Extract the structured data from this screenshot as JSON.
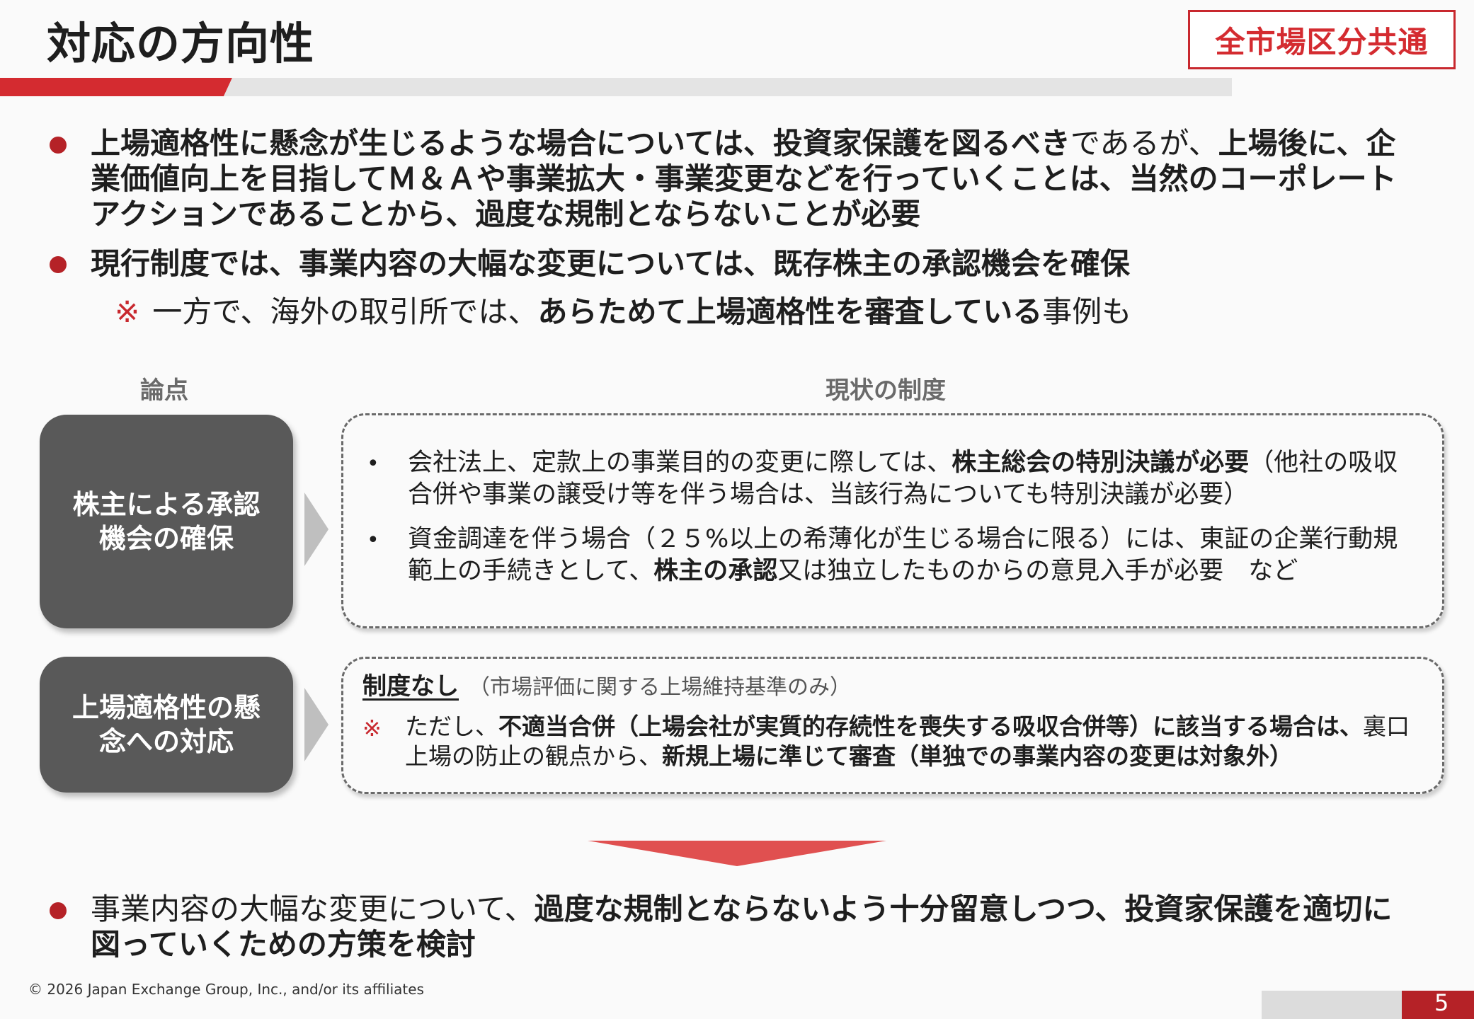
{
  "header": {
    "title": "対応の方向性",
    "badge": "全市場区分共通"
  },
  "bullets": {
    "p1": {
      "s1": "上場適格性に懸念が生じるような場合については、投資家保護を図るべき",
      "s2": "であるが、",
      "s3": "上場後に、企業価値向上を目指してＭ＆Ａや事業拡大・事業変更などを行っていくことは、当然のコーポレートアクションであることから、過度な規制とならないことが必要"
    },
    "p2": "現行制度では、事業内容の大幅な変更については、既存株主の承認機会を確保",
    "note1": {
      "mark": "※",
      "s1": "一方で、海外の取引所では、",
      "s2": "あらためて上場適格性を審査している",
      "s3": "事例も"
    }
  },
  "table": {
    "head_issue": "論点",
    "head_current": "現状の制度",
    "issue1": "株主による承認\n機会の確保",
    "issue2": "上場適格性の懸\n念への対応",
    "box1": {
      "item1": {
        "dot": "•",
        "s1": "会社法上、定款上の事業目的の変更に際しては、",
        "s2": "株主総会の特別決議が必要",
        "s3": "（他社の吸収合併や事業の譲受け等を伴う場合は、当該行為についても特別決議が必要）"
      },
      "item2": {
        "dot": "•",
        "s1": "資金調達を伴う場合（２５%以上の希薄化が生じる場合に限る）には、東証の企業行動規範上の手続きとして、",
        "s2": "株主の承認",
        "s3": "又は独立したものからの意見入手が必要　など"
      }
    },
    "box2": {
      "title": "制度なし",
      "paren": "（市場評価に関する上場維持基準のみ）",
      "mark": "※",
      "s1": "ただし、",
      "s2": "不適当合併（上場会社が実質的存続性を喪失する吸収合併等）に該当する場合は、",
      "s3": "裏口上場の防止の観点から、",
      "s4": "新規上場に準じて審査（単独での事業内容の変更は対象外）"
    }
  },
  "conclusion": {
    "s1": "事業内容の大幅な変更について、",
    "s2": "過度な規制とならないよう十分留意しつつ、投資家保護を適切に図っていくための方策を検討"
  },
  "footer": {
    "copyright": "© 2026 Japan Exchange Group, Inc., and/or its affiliates",
    "page": "5"
  },
  "colors": {
    "accent_red": "#b52227",
    "badge_red": "#d42b30",
    "issue_box": "#595959",
    "arrow_red": "#e05050"
  }
}
